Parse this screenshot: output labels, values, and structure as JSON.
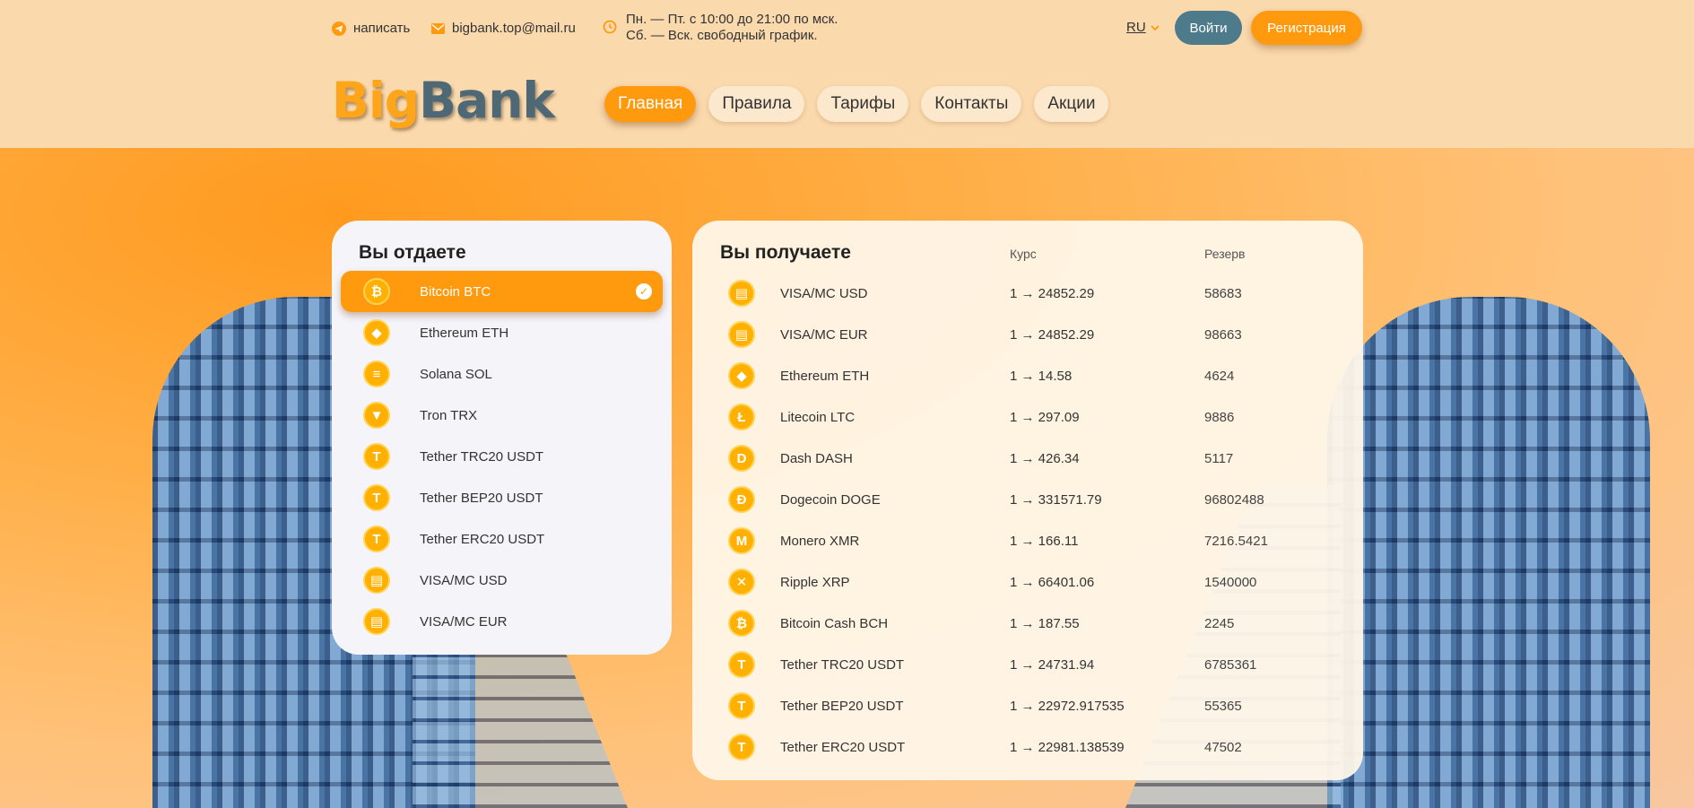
{
  "header": {
    "contacts": {
      "telegram_label": "написать",
      "email": "bigbank.top@mail.ru",
      "hours_line1": "Пн. — Пт. с 10:00 до 21:00 по мск.",
      "hours_line2": "Сб. — Вск. свободный график."
    },
    "language": "RU",
    "login_label": "Войти",
    "register_label": "Регистрация",
    "logo": {
      "part1": "Big",
      "part2": "Bank"
    },
    "nav": [
      {
        "label": "Главная",
        "active": true
      },
      {
        "label": "Правила",
        "active": false
      },
      {
        "label": "Тарифы",
        "active": false
      },
      {
        "label": "Контакты",
        "active": false
      },
      {
        "label": "Акции",
        "active": false
      }
    ]
  },
  "give": {
    "title": "Вы отдаете",
    "items": [
      {
        "name": "Bitcoin BTC",
        "icon": "bitcoin-icon",
        "glyph": "₿",
        "selected": true
      },
      {
        "name": "Ethereum ETH",
        "icon": "ethereum-icon",
        "glyph": "◆"
      },
      {
        "name": "Solana SOL",
        "icon": "solana-icon",
        "glyph": "≡"
      },
      {
        "name": "Tron TRX",
        "icon": "tron-icon",
        "glyph": "▼"
      },
      {
        "name": "Tether TRC20 USDT",
        "icon": "tether-icon",
        "glyph": "T"
      },
      {
        "name": "Tether BEP20 USDT",
        "icon": "tether-icon",
        "glyph": "T"
      },
      {
        "name": "Tether ERC20 USDT",
        "icon": "tether-icon",
        "glyph": "T"
      },
      {
        "name": "VISA/MC USD",
        "icon": "card-icon",
        "glyph": "▤"
      },
      {
        "name": "VISA/MC EUR",
        "icon": "card-icon",
        "glyph": "▤"
      }
    ]
  },
  "receive": {
    "title": "Вы получаете",
    "rate_header": "Курс",
    "reserve_header": "Резерв",
    "items": [
      {
        "name": "VISA/MC USD",
        "rate": "1 → 24852.29",
        "reserve": "58683",
        "icon": "card-icon",
        "glyph": "▤"
      },
      {
        "name": "VISA/MC EUR",
        "rate": "1 → 24852.29",
        "reserve": "98663",
        "icon": "card-icon",
        "glyph": "▤"
      },
      {
        "name": "Ethereum ETH",
        "rate": "1 → 14.58",
        "reserve": "4624",
        "icon": "ethereum-icon",
        "glyph": "◆"
      },
      {
        "name": "Litecoin LTC",
        "rate": "1 → 297.09",
        "reserve": "9886",
        "icon": "litecoin-icon",
        "glyph": "Ł"
      },
      {
        "name": "Dash DASH",
        "rate": "1 → 426.34",
        "reserve": "5117",
        "icon": "dash-icon",
        "glyph": "D"
      },
      {
        "name": "Dogecoin DOGE",
        "rate": "1 → 331571.79",
        "reserve": "96802488",
        "icon": "dogecoin-icon",
        "glyph": "Ð"
      },
      {
        "name": "Monero XMR",
        "rate": "1 → 166.11",
        "reserve": "7216.5421",
        "icon": "monero-icon",
        "glyph": "M"
      },
      {
        "name": "Ripple XRP",
        "rate": "1 → 66401.06",
        "reserve": "1540000",
        "icon": "ripple-icon",
        "glyph": "✕"
      },
      {
        "name": "Bitcoin Cash BCH",
        "rate": "1 → 187.55",
        "reserve": "2245",
        "icon": "bitcoin-cash-icon",
        "glyph": "₿"
      },
      {
        "name": "Tether TRC20 USDT",
        "rate": "1 → 24731.94",
        "reserve": "6785361",
        "icon": "tether-icon",
        "glyph": "T"
      },
      {
        "name": "Tether BEP20 USDT",
        "rate": "1 → 22972.917535",
        "reserve": "55365",
        "icon": "tether-icon",
        "glyph": "T"
      },
      {
        "name": "Tether ERC20 USDT",
        "rate": "1 → 22981.138539",
        "reserve": "47502",
        "icon": "tether-icon",
        "glyph": "T"
      }
    ]
  },
  "colors": {
    "accent": "#ff9a0f",
    "login": "#4d7b8b",
    "header_bg": "#fad9ad"
  }
}
